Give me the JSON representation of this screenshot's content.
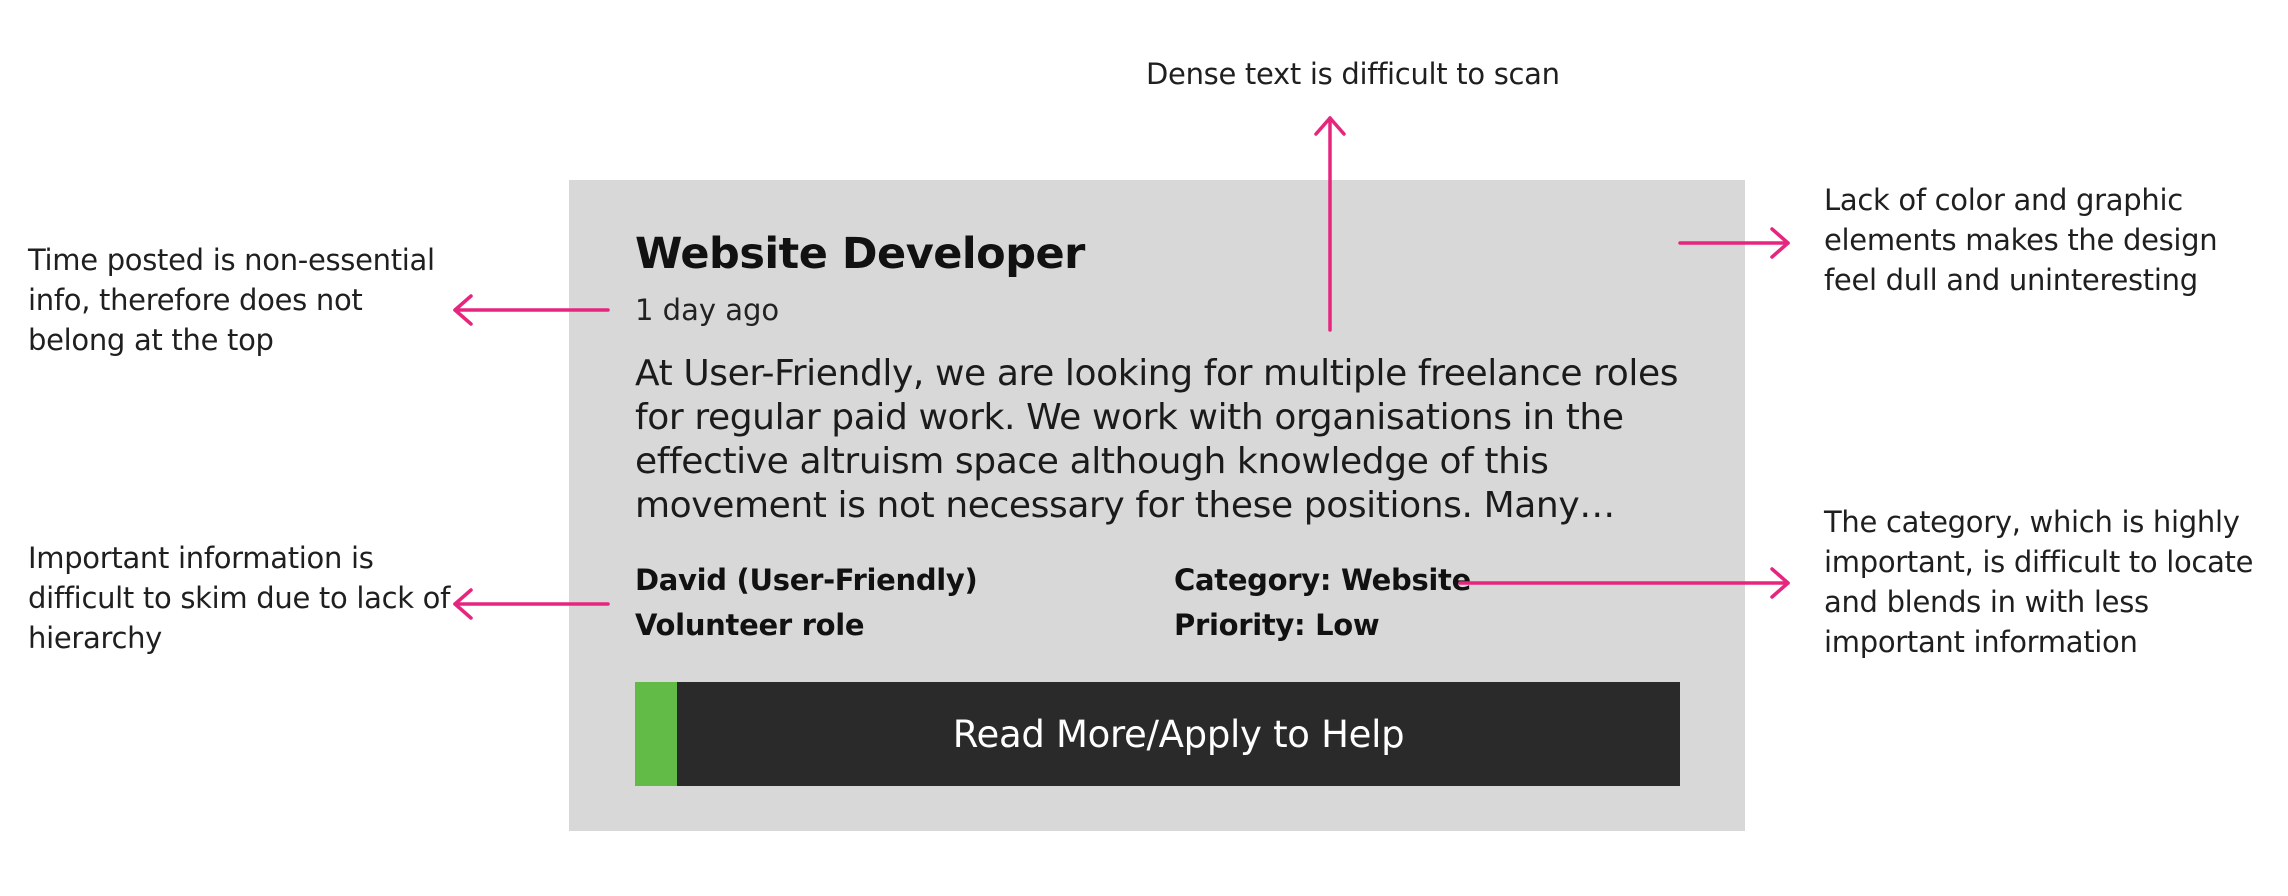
{
  "annotations": {
    "top": "Dense text is difficult to scan",
    "left_top": "Time posted is non-essential info, therefore does not belong at the top",
    "left_bottom": "Important information is difficult to skim due to lack of hierarchy",
    "right_top": "Lack of color and graphic elements makes the design feel dull and uninteresting",
    "right_bottom": "The category, which is highly important, is difficult to locate and blends in with less important information"
  },
  "card": {
    "title": "Website Developer",
    "time_posted": "1 day ago",
    "description": "At User-Friendly, we are looking for multiple freelance roles for regular paid work. We work with organisations in the effective altruism space although knowledge of this movement is not necessary for these positions. Many…",
    "poster": "David (User-Friendly)",
    "role": "Volunteer role",
    "category": "Category: Website",
    "priority": "Priority: Low",
    "cta_label": "Read More/Apply to Help"
  },
  "colors": {
    "card_bg": "#d8d8d8",
    "cta_bg": "#2a2a2a",
    "cta_accent": "#62bb47",
    "arrow": "#e6267e"
  },
  "icons": [
    "arrow-up-icon",
    "arrow-left-icon",
    "arrow-right-icon"
  ]
}
